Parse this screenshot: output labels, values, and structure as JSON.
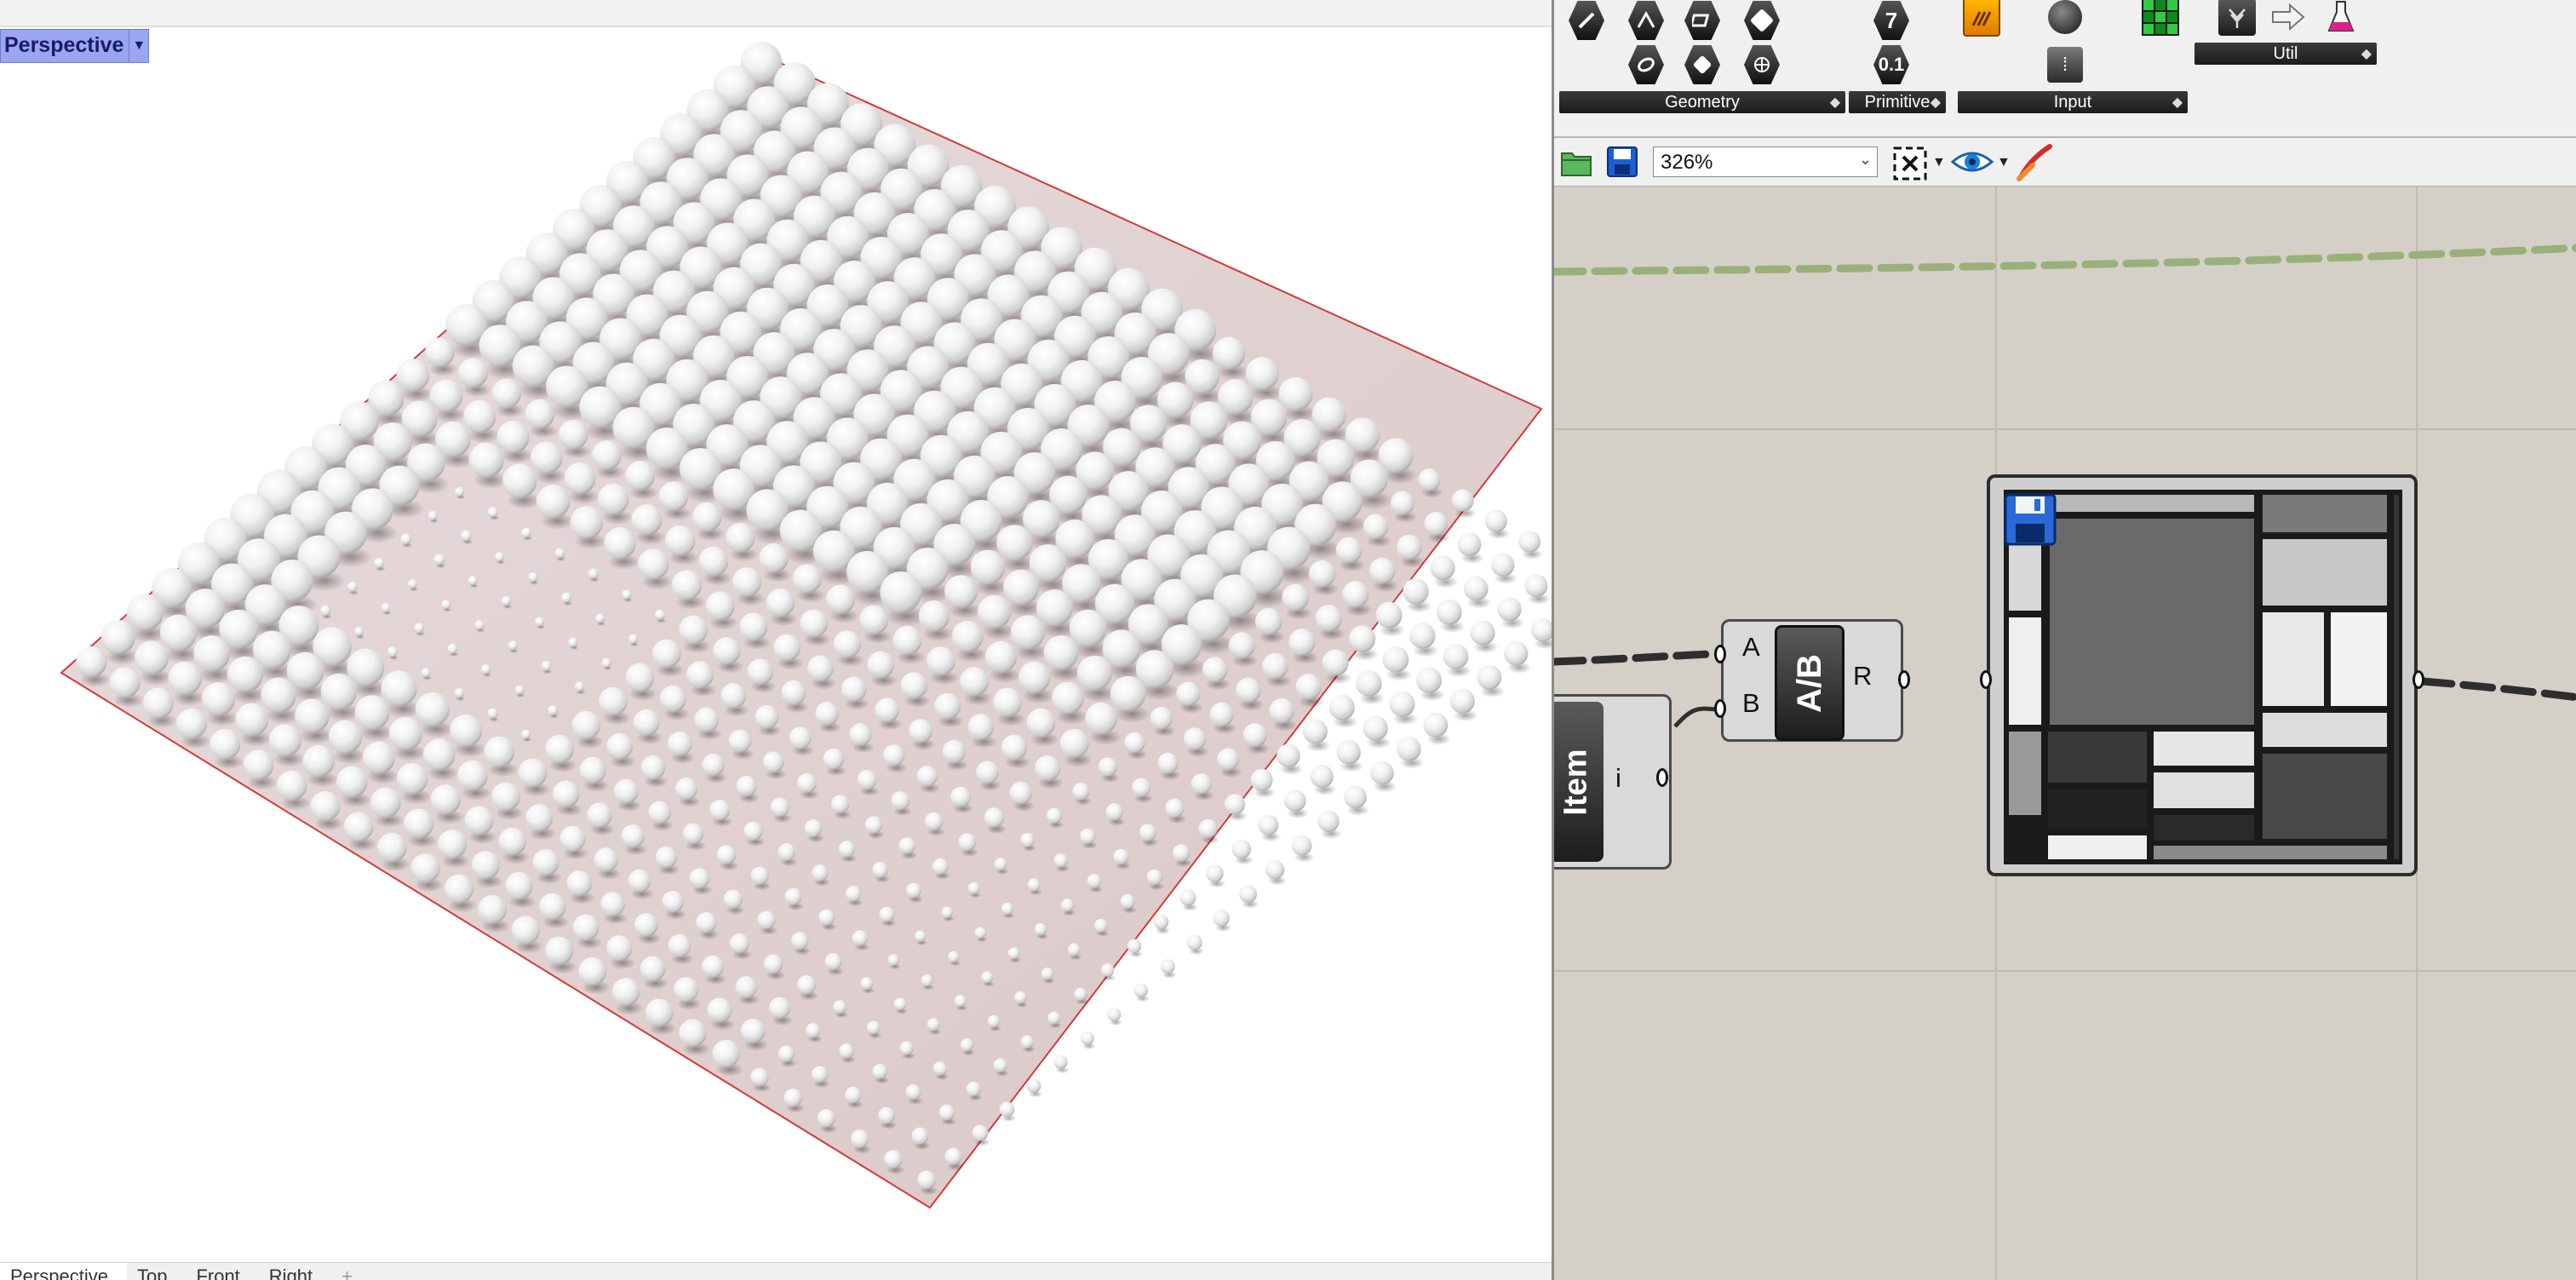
{
  "rhino": {
    "viewport_title": "Perspective",
    "viewport_tabs": [
      "Perspective",
      "Top",
      "Front",
      "Right"
    ],
    "add_tab_glyph": "+"
  },
  "grasshopper": {
    "ribbon": {
      "groups": [
        {
          "label": "Geometry"
        },
        {
          "label": "Primitive"
        },
        {
          "label": "Input"
        },
        {
          "label": "Util"
        }
      ],
      "primitive_icons": [
        "7",
        "0.1"
      ]
    },
    "canvas_toolbar": {
      "zoom": "326%"
    },
    "components": {
      "item": {
        "badge": "Item",
        "output": "i"
      },
      "divide": {
        "badge": "A/B",
        "inputs": [
          "A",
          "B"
        ],
        "output": "R"
      }
    }
  },
  "colors": {
    "viewport_title_bg": "#9aa6f0",
    "canvas_bg": "#d4d0c8",
    "wire_dark": "#2e2e2e",
    "wire_green": "#9ab07a",
    "boundary_red": "#d23a3a"
  }
}
